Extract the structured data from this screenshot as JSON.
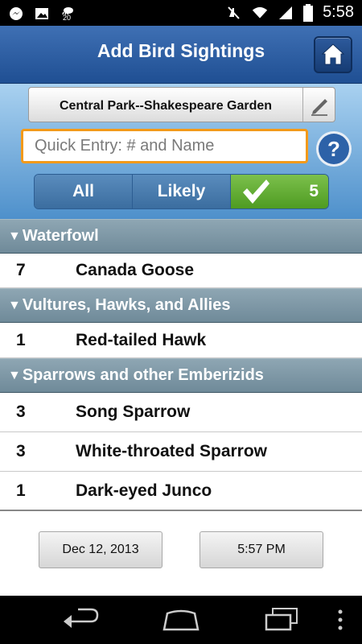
{
  "status_bar": {
    "time": "5:58",
    "left_icons": [
      "messenger-icon",
      "gallery-icon",
      "weather-icon"
    ],
    "weather_temp": "20",
    "right_icons": [
      "mute-icon",
      "wifi-icon",
      "signal-icon",
      "battery-icon"
    ]
  },
  "header": {
    "title": "Add Bird Sightings",
    "home_icon": "home-icon"
  },
  "location": {
    "label": "Central Park--Shakespeare Garden",
    "edit_icon": "pencil-icon"
  },
  "quick_entry": {
    "placeholder": "Quick Entry: # and Name",
    "value": ""
  },
  "filters": {
    "all": "All",
    "likely": "Likely",
    "checked_count": "5",
    "selected": "checked"
  },
  "categories": [
    {
      "name": "Waterfowl",
      "rows": [
        {
          "count": "7",
          "name": "Canada Goose"
        }
      ]
    },
    {
      "name": "Vultures, Hawks, and Allies",
      "rows": [
        {
          "count": "1",
          "name": "Red-tailed Hawk"
        }
      ]
    },
    {
      "name": "Sparrows and other Emberizids",
      "rows": [
        {
          "count": "3",
          "name": "Song Sparrow"
        },
        {
          "count": "3",
          "name": "White-throated Sparrow"
        },
        {
          "count": "1",
          "name": "Dark-eyed Junco"
        }
      ]
    }
  ],
  "footer": {
    "date": "Dec 12, 2013",
    "time": "5:57 PM"
  },
  "colors": {
    "header": "#2f5fa3",
    "accent_orange": "#f39a1a",
    "checked_green": "#5faa2f",
    "category_bg": "#7f98a6"
  }
}
